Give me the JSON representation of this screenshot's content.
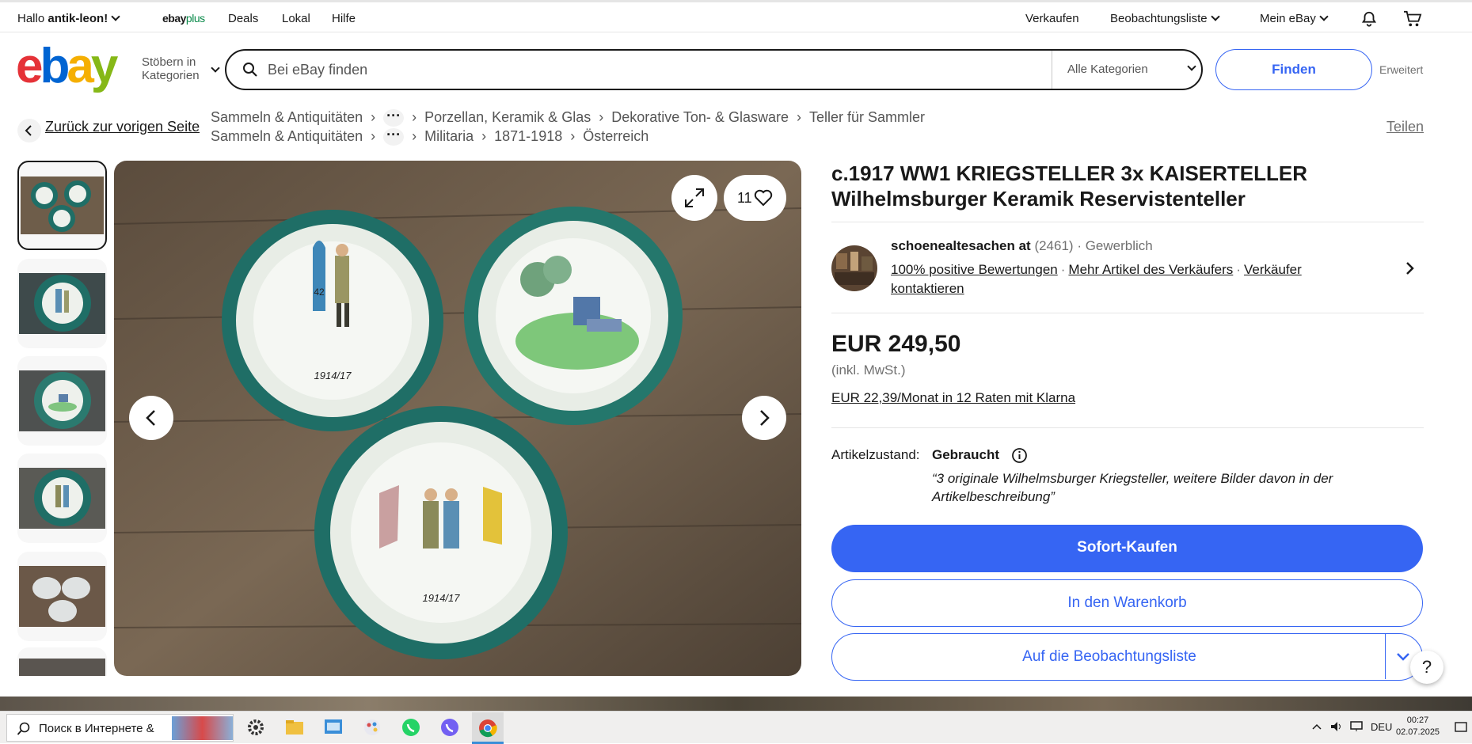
{
  "topbar": {
    "greeting_prefix": "Hallo ",
    "username": "antik-leon!",
    "ebayplus_ebay": "ebay",
    "ebayplus_plus": "plus",
    "deals": "Deals",
    "local": "Lokal",
    "help": "Hilfe",
    "sell": "Verkaufen",
    "watchlist": "Beobachtungsliste",
    "my_ebay": "Mein eBay"
  },
  "header": {
    "logo": {
      "e": "e",
      "b": "b",
      "a": "a",
      "y": "y"
    },
    "browse_line1": "Stöbern in",
    "browse_line2": "Kategorien",
    "search_placeholder": "Bei eBay finden",
    "category_select": "Alle Kategorien",
    "find_button": "Finden",
    "advanced": "Erweitert"
  },
  "breadcrumbs": {
    "back": "Zurück zur vorigen Seite",
    "row1": [
      "Sammeln & Antiquitäten",
      "Porzellan, Keramik & Glas",
      "Dekorative Ton- & Glasware",
      "Teller für Sammler"
    ],
    "row2": [
      "Sammeln & Antiquitäten",
      "Militaria",
      "1871-1918",
      "Österreich"
    ],
    "dots": "···",
    "share": "Teilen"
  },
  "gallery": {
    "favorite_count": "11",
    "plate_year_1": "1914/17",
    "plate_year_2": "1914/17",
    "plate_number": "42"
  },
  "listing": {
    "title": "c.1917 WW1 KRIEGSTELLER 3x KAISERTELLER Wilhelmsburger Keramik Reservistenteller",
    "seller": {
      "name": "schoenealtesachen at",
      "rating_count": "(2461)",
      "type": "· Gewerblich",
      "positive": "100% positive Bewertungen",
      "more_items": "Mehr Artikel des Verkäufers",
      "contact": "Verkäufer kontaktieren"
    },
    "price": "EUR 249,50",
    "vat": "(inkl. MwSt.)",
    "klarna": "EUR 22,39/Monat in 12 Raten mit Klarna",
    "condition_label": "Artikelzustand:",
    "condition_value": "Gebraucht",
    "condition_note": "“3 originale Wilhelmsburger Kriegsteller, weitere Bilder davon in der Artikelbeschreibung”",
    "buy_now": "Sofort-Kaufen",
    "add_to_cart": "In den Warenkorb",
    "add_to_watchlist": "Auf die Beobachtungsliste",
    "help": "?"
  },
  "taskbar": {
    "search_text": "Поиск в Интернете &",
    "language": "DEU",
    "time": "00:27",
    "date": "02.07.2025"
  },
  "colors": {
    "primary_blue": "#3665f3",
    "ebay_red": "#e53238",
    "ebay_blue": "#0064d2",
    "ebay_yellow": "#f5af02",
    "ebay_green": "#86b817"
  }
}
